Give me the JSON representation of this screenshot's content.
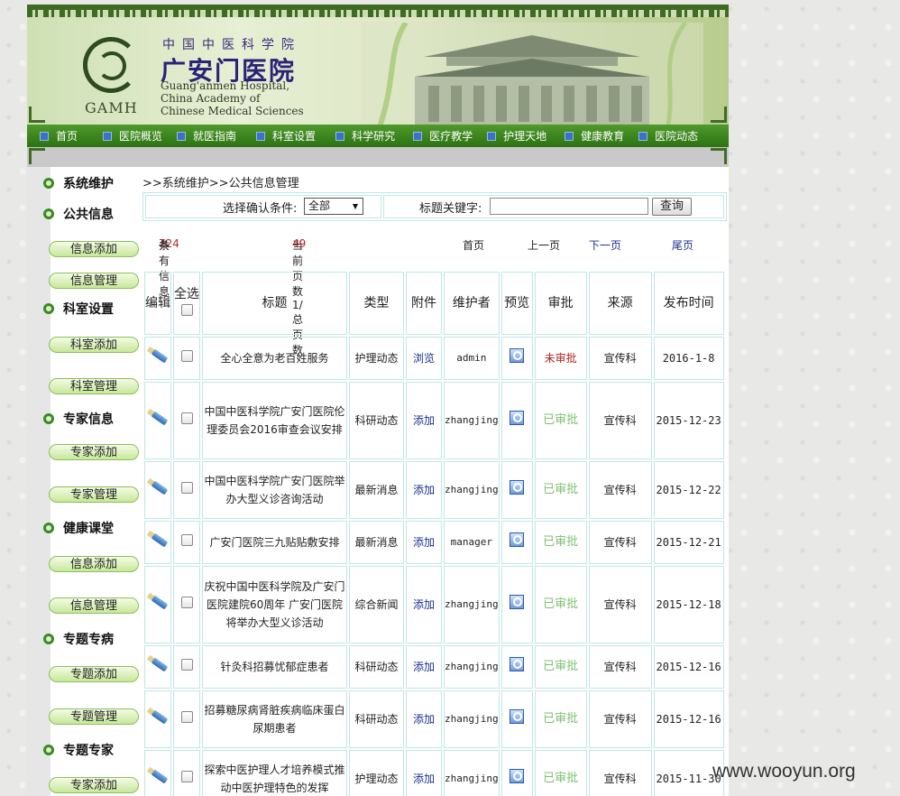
{
  "header": {
    "sub_cn": "中国中医科学院",
    "main_cn": "广安门医院",
    "logo_text": "GAMH",
    "en_lines": [
      "Guang'anmen Hospital,",
      "China Academy of",
      "Chinese Medical Sciences"
    ]
  },
  "nav": {
    "items": [
      "首页",
      "医院概览",
      "就医指南",
      "科室设置",
      "科学研究",
      "医疗教学",
      "护理天地",
      "健康教育",
      "医院动态"
    ]
  },
  "sidebar": {
    "sections": [
      {
        "title": "系统维护"
      },
      {
        "title": "公共信息",
        "buttons": [
          "信息添加",
          "信息管理"
        ]
      },
      {
        "title": "科室设置",
        "buttons": [
          "科室添加",
          "科室管理"
        ]
      },
      {
        "title": "专家信息",
        "buttons": [
          "专家添加",
          "专家管理"
        ]
      },
      {
        "title": "健康课堂",
        "buttons": [
          "信息添加",
          "信息管理"
        ]
      },
      {
        "title": "专题专病",
        "buttons": [
          "专题添加",
          "专题管理"
        ]
      },
      {
        "title": "专题专家",
        "buttons": [
          "专家添加"
        ]
      }
    ]
  },
  "breadcrumb": ">>系统维护>>公共信息管理",
  "filter": {
    "condition_label": "选择确认条件:",
    "condition_value": "全部",
    "keyword_label": "标题关键字:",
    "keyword_value": "",
    "query_label": "查询"
  },
  "pager": {
    "total_prefix": "共有信息",
    "total_count": "724",
    "total_suffix": "条",
    "page_prefix": "当前页数1/总页数",
    "page_total": "49",
    "first": "首页",
    "prev": "上一页",
    "next": "下一页",
    "last": "尾页"
  },
  "table": {
    "headers": {
      "edit": "编辑",
      "select_all": "全选",
      "title": "标题",
      "type": "类型",
      "attach": "附件",
      "maintainer": "维护者",
      "preview": "预览",
      "review": "审批",
      "source": "来源",
      "date": "发布时间"
    },
    "rows": [
      {
        "title": "全心全意为老百姓服务",
        "type": "护理动态",
        "attach": "浏览",
        "maintainer": "admin",
        "review": "未审批",
        "source": "宣传科",
        "date": "2016-1-8"
      },
      {
        "title": "中国中医科学院广安门医院伦理委员会2016审查会议安排",
        "type": "科研动态",
        "attach": "添加",
        "maintainer": "zhangjing",
        "review": "已审批",
        "source": "宣传科",
        "date": "2015-12-23"
      },
      {
        "title": "中国中医科学院广安门医院举办大型义诊咨询活动",
        "type": "最新消息",
        "attach": "添加",
        "maintainer": "zhangjing",
        "review": "已审批",
        "source": "宣传科",
        "date": "2015-12-22"
      },
      {
        "title": "广安门医院三九贴贴敷安排",
        "type": "最新消息",
        "attach": "添加",
        "maintainer": "manager",
        "review": "已审批",
        "source": "宣传科",
        "date": "2015-12-21"
      },
      {
        "title": "庆祝中国中医科学院及广安门医院建院60周年 广安门医院将举办大型义诊活动",
        "type": "综合新闻",
        "attach": "添加",
        "maintainer": "zhangjing",
        "review": "已审批",
        "source": "宣传科",
        "date": "2015-12-18"
      },
      {
        "title": "针灸科招募忧郁症患者",
        "type": "科研动态",
        "attach": "添加",
        "maintainer": "zhangjing",
        "review": "已审批",
        "source": "宣传科",
        "date": "2015-12-16"
      },
      {
        "title": "招募糖尿病肾脏疾病临床蛋白尿期患者",
        "type": "科研动态",
        "attach": "添加",
        "maintainer": "zhangjing",
        "review": "已审批",
        "source": "宣传科",
        "date": "2015-12-16"
      },
      {
        "title": "探索中医护理人才培养模式推动中医护理特色的发挥",
        "type": "护理动态",
        "attach": "添加",
        "maintainer": "zhangjing",
        "review": "已审批",
        "source": "宣传科",
        "date": "2015-11-30"
      }
    ]
  },
  "watermark": "www.wooyun.org"
}
